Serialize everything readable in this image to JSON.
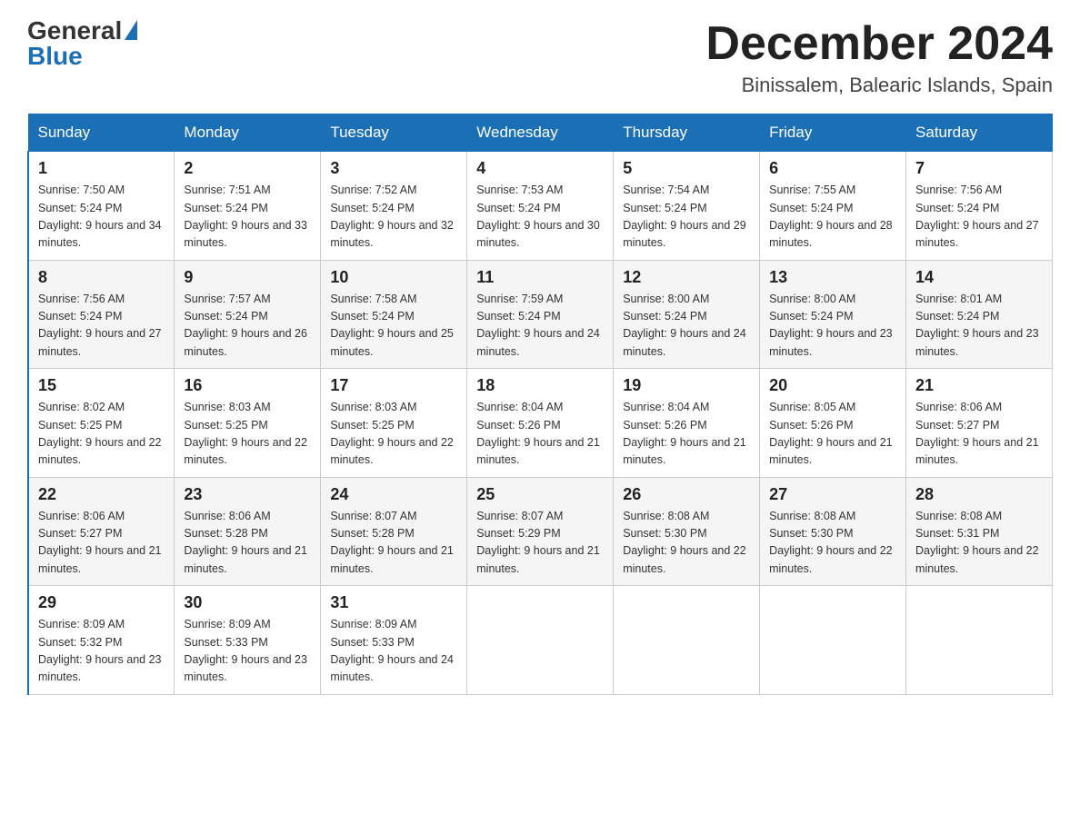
{
  "header": {
    "logo_general": "General",
    "logo_blue": "Blue",
    "month_title": "December 2024",
    "location": "Binissalem, Balearic Islands, Spain"
  },
  "days_of_week": [
    "Sunday",
    "Monday",
    "Tuesday",
    "Wednesday",
    "Thursday",
    "Friday",
    "Saturday"
  ],
  "weeks": [
    [
      {
        "day": "1",
        "sunrise": "7:50 AM",
        "sunset": "5:24 PM",
        "daylight": "9 hours and 34 minutes."
      },
      {
        "day": "2",
        "sunrise": "7:51 AM",
        "sunset": "5:24 PM",
        "daylight": "9 hours and 33 minutes."
      },
      {
        "day": "3",
        "sunrise": "7:52 AM",
        "sunset": "5:24 PM",
        "daylight": "9 hours and 32 minutes."
      },
      {
        "day": "4",
        "sunrise": "7:53 AM",
        "sunset": "5:24 PM",
        "daylight": "9 hours and 30 minutes."
      },
      {
        "day": "5",
        "sunrise": "7:54 AM",
        "sunset": "5:24 PM",
        "daylight": "9 hours and 29 minutes."
      },
      {
        "day": "6",
        "sunrise": "7:55 AM",
        "sunset": "5:24 PM",
        "daylight": "9 hours and 28 minutes."
      },
      {
        "day": "7",
        "sunrise": "7:56 AM",
        "sunset": "5:24 PM",
        "daylight": "9 hours and 27 minutes."
      }
    ],
    [
      {
        "day": "8",
        "sunrise": "7:56 AM",
        "sunset": "5:24 PM",
        "daylight": "9 hours and 27 minutes."
      },
      {
        "day": "9",
        "sunrise": "7:57 AM",
        "sunset": "5:24 PM",
        "daylight": "9 hours and 26 minutes."
      },
      {
        "day": "10",
        "sunrise": "7:58 AM",
        "sunset": "5:24 PM",
        "daylight": "9 hours and 25 minutes."
      },
      {
        "day": "11",
        "sunrise": "7:59 AM",
        "sunset": "5:24 PM",
        "daylight": "9 hours and 24 minutes."
      },
      {
        "day": "12",
        "sunrise": "8:00 AM",
        "sunset": "5:24 PM",
        "daylight": "9 hours and 24 minutes."
      },
      {
        "day": "13",
        "sunrise": "8:00 AM",
        "sunset": "5:24 PM",
        "daylight": "9 hours and 23 minutes."
      },
      {
        "day": "14",
        "sunrise": "8:01 AM",
        "sunset": "5:24 PM",
        "daylight": "9 hours and 23 minutes."
      }
    ],
    [
      {
        "day": "15",
        "sunrise": "8:02 AM",
        "sunset": "5:25 PM",
        "daylight": "9 hours and 22 minutes."
      },
      {
        "day": "16",
        "sunrise": "8:03 AM",
        "sunset": "5:25 PM",
        "daylight": "9 hours and 22 minutes."
      },
      {
        "day": "17",
        "sunrise": "8:03 AM",
        "sunset": "5:25 PM",
        "daylight": "9 hours and 22 minutes."
      },
      {
        "day": "18",
        "sunrise": "8:04 AM",
        "sunset": "5:26 PM",
        "daylight": "9 hours and 21 minutes."
      },
      {
        "day": "19",
        "sunrise": "8:04 AM",
        "sunset": "5:26 PM",
        "daylight": "9 hours and 21 minutes."
      },
      {
        "day": "20",
        "sunrise": "8:05 AM",
        "sunset": "5:26 PM",
        "daylight": "9 hours and 21 minutes."
      },
      {
        "day": "21",
        "sunrise": "8:06 AM",
        "sunset": "5:27 PM",
        "daylight": "9 hours and 21 minutes."
      }
    ],
    [
      {
        "day": "22",
        "sunrise": "8:06 AM",
        "sunset": "5:27 PM",
        "daylight": "9 hours and 21 minutes."
      },
      {
        "day": "23",
        "sunrise": "8:06 AM",
        "sunset": "5:28 PM",
        "daylight": "9 hours and 21 minutes."
      },
      {
        "day": "24",
        "sunrise": "8:07 AM",
        "sunset": "5:28 PM",
        "daylight": "9 hours and 21 minutes."
      },
      {
        "day": "25",
        "sunrise": "8:07 AM",
        "sunset": "5:29 PM",
        "daylight": "9 hours and 21 minutes."
      },
      {
        "day": "26",
        "sunrise": "8:08 AM",
        "sunset": "5:30 PM",
        "daylight": "9 hours and 22 minutes."
      },
      {
        "day": "27",
        "sunrise": "8:08 AM",
        "sunset": "5:30 PM",
        "daylight": "9 hours and 22 minutes."
      },
      {
        "day": "28",
        "sunrise": "8:08 AM",
        "sunset": "5:31 PM",
        "daylight": "9 hours and 22 minutes."
      }
    ],
    [
      {
        "day": "29",
        "sunrise": "8:09 AM",
        "sunset": "5:32 PM",
        "daylight": "9 hours and 23 minutes."
      },
      {
        "day": "30",
        "sunrise": "8:09 AM",
        "sunset": "5:33 PM",
        "daylight": "9 hours and 23 minutes."
      },
      {
        "day": "31",
        "sunrise": "8:09 AM",
        "sunset": "5:33 PM",
        "daylight": "9 hours and 24 minutes."
      },
      null,
      null,
      null,
      null
    ]
  ],
  "labels": {
    "sunrise_prefix": "Sunrise: ",
    "sunset_prefix": "Sunset: ",
    "daylight_prefix": "Daylight: "
  }
}
